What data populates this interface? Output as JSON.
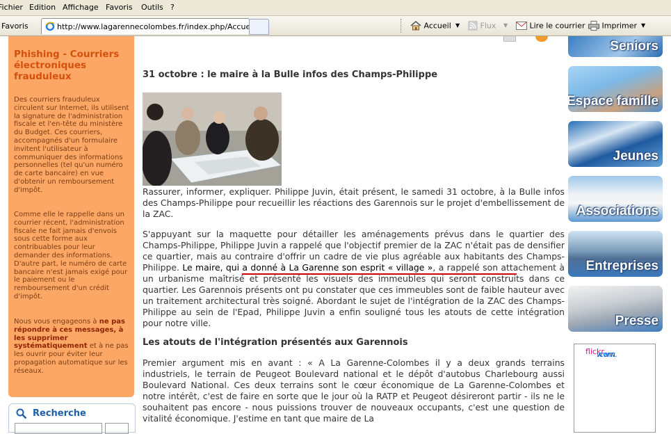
{
  "menu": [
    "Fichier",
    "Edition",
    "Affichage",
    "Favoris",
    "Outils",
    "?"
  ],
  "toolbar": {
    "favoris": "Favoris",
    "tab_url": "http://www.lagarennecolombes.fr/index.php/Accueil?...",
    "accueil": "Accueil",
    "flux": "Flux",
    "lire_courrier": "Lire le courrier",
    "imprimer": "Imprimer"
  },
  "left": {
    "title": "Phishing - Courriers électroniques frauduleux",
    "p1": "Des courriers frauduleux circulent sur Internet, ils utilisent la signature de l'administration fiscale et l'en-tête du ministère du Budget. Ces courriers, accompagnés d'un formulaire invitent l'utilisateur à communiquer des informations personnelles (tel qu'un numéro de carte bancaire) en vue d'obtenir un remboursement d'impôt.",
    "p2": "Comme elle le rappelle dans un courrier récent, l'administration fiscale ne fait jamais d'envois sous cette forme aux contribuables pour leur demander des informations. D'autre part, le numéro de carte bancaire n'est jamais exigé pour le paiement ou le remboursement d'un crédit d'impôt.",
    "p3_a": "Nous vous engageons à ",
    "p3_b": "ne pas répondre à ces messages, à les supprimer systématiquement",
    "p3_c": " et à ne pas les ouvrir pour éviter leur propagation automatique sur les réseaux.",
    "search_label": "Recherche"
  },
  "article": {
    "title": "31 octobre : le maire à la Bulle infos des Champs-Philippe",
    "p1": "Rassurer, informer, expliquer. Philippe Juvin, était présent, le samedi 31 octobre, à la Bulle infos des Champs-Philippe pour recueillir les réactions des Garennois sur le projet d'embellissement de la ZAC.",
    "p2_a": "S'appuyant sur la maquette pour détailler les aménagements prévus dans le quartier des Champs-Philippe, Philippe Juvin a rappelé que l'objectif premier de la ZAC n'était pas de densifier ce quartier, mais au contraire d'offrir un cadre de vie plus agréable aux habitants des Champs-Philippe. ",
    "p2_hl": "Le maire, qui a donné à La Garenne son esprit « village »",
    "p2_b": ", a rappelé son attachement à un urbanisme maîtrisé et présenté les visuels des immeubles qui seront construits dans ce quartier. Les Garennois présents ont pu constater que ces immeubles sont de faible hauteur avec un traitement architectural très soigné. Abordant le sujet de l'intégration de la ZAC des Champs-Philippe au sein de l'Epad, Philippe Juvin a enfin souligné tous les atouts de cette intégration pour notre ville.",
    "subtitle": "Les atouts de l'intégration présentés aux Garennois",
    "p3": "Premier argument mis en avant : « A La Garenne-Colombes il y a deux grands terrains industriels, le terrain de Peugeot Boulevard national et le dépôt d'autobus Charlebourg aussi Boulevard National. Ces deux terrains sont le cœur économique de La Garenne-Colombes et notre intérêt, c'est de faire en sorte que le jour où la RATP et Peugeot désireront partir - ils ne le souhaitent pas encore - nous puissions trouver de nouveaux occupants, c'est une question de vitalité économique. J'estime en tant que maire de La"
  },
  "right_nav": [
    "Seniors",
    "Espace famille",
    "Jeunes",
    "Associations",
    "Entreprises",
    "Presse"
  ],
  "flickr": {
    "a": "www.",
    "b": "flickr",
    "c": ".com"
  }
}
